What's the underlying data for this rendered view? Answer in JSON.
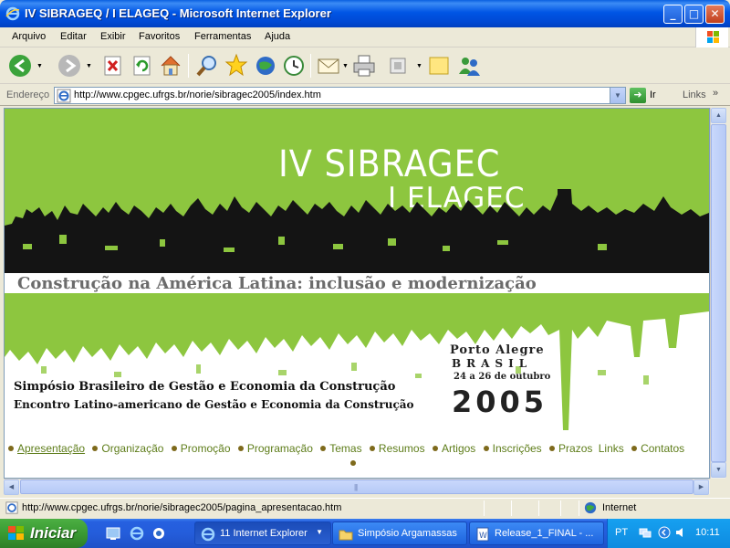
{
  "window": {
    "title": "IV SIBRAGEQ / I ELAGEQ - Microsoft Internet Explorer",
    "minimize_glyph": "_",
    "maximize_glyph": "□",
    "close_glyph": "✕"
  },
  "menu": {
    "items": [
      "Arquivo",
      "Editar",
      "Exibir",
      "Favoritos",
      "Ferramentas",
      "Ajuda"
    ]
  },
  "toolbar": {
    "icons": [
      "back-icon",
      "forward-icon",
      "stop-icon",
      "refresh-icon",
      "home-icon",
      "search-icon",
      "favorites-icon",
      "media-icon",
      "history-icon",
      "mail-icon",
      "print-icon",
      "edit-icon",
      "discuss-icon",
      "messenger-icon"
    ]
  },
  "address": {
    "label": "Endereço",
    "url": "http://www.cpgec.ufrgs.br/norie/sibragec2005/index.htm",
    "go_label": "Ir",
    "links_label": "Links",
    "chevron": "»"
  },
  "banner": {
    "title_line1": "IV SIBRAGEC",
    "title_line2": "I ELAGEC",
    "subtitle": "Construção na América Latina: inclusão e modernização",
    "city": "Porto Alegre",
    "country": "BRASIL",
    "dates": "24 a 26 de outubro",
    "year": "2005",
    "event1": "Simpósio Brasileiro de Gestão e Economia da Construção",
    "event2": "Encontro Latino-americano de Gestão e Economia da Construção",
    "green_color": "#8DC63F"
  },
  "nav": {
    "links": [
      "Apresentação",
      "Organização",
      "Promoção",
      "Programação",
      "Temas",
      "Resumos",
      "Artigos",
      "Inscrições",
      "Prazos",
      "Links",
      "Contatos"
    ]
  },
  "status": {
    "text": "http://www.cpgec.ufrgs.br/norie/sibragec2005/pagina_apresentacao.htm",
    "zone": "Internet"
  },
  "taskbar": {
    "start_label": "Iniciar",
    "tasks": [
      {
        "label": "11 Internet Explorer",
        "active": true
      },
      {
        "label": "Simpósio Argamassas",
        "active": false
      },
      {
        "label": "Release_1_FINAL - ...",
        "active": false
      }
    ],
    "lang": "PT",
    "clock": "10:11"
  }
}
